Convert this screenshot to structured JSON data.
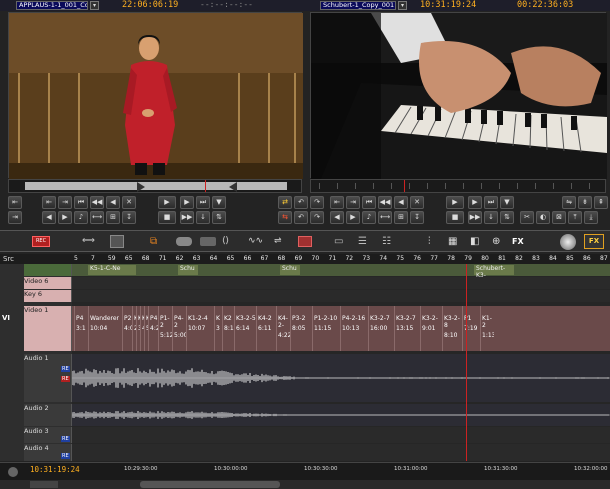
{
  "source_monitor": {
    "clip_name": "APPLAUS-1-1_001_Cop",
    "timecode": "22:06:06:19",
    "timecode_dim": "--:--:--:--"
  },
  "record_monitor": {
    "clip_name": "Schubert-1_Copy_001",
    "timecode": "10:31:19:24",
    "duration": "00:22:36:03"
  },
  "timeline": {
    "src_label": "Src",
    "ruler_numbers": [
      "5",
      "7",
      "59",
      "65",
      "68",
      "71",
      "62",
      "63",
      "64",
      "65",
      "66",
      "67",
      "68",
      "69",
      "70",
      "71",
      "72",
      "73",
      "74",
      "75",
      "76",
      "77",
      "78",
      "79",
      "80",
      "81",
      "82",
      "83",
      "84",
      "85",
      "86",
      "87"
    ],
    "filler_labels": [
      "K5-1-C-Ne",
      "Schu",
      "Schu",
      "Schubert-K3-"
    ],
    "tracks": {
      "video6": "Video 6",
      "key6": "Key 6",
      "vi": "VI",
      "video1": "Video 1",
      "audio1": "Audio 1",
      "audio2": "Audio 2",
      "audio3": "Audio 3",
      "audio4": "Audio 4"
    },
    "audio_markers": [
      "RE",
      "RE",
      "RE",
      "RE"
    ],
    "video_clips": [
      {
        "name": "P4",
        "tc": "3:1"
      },
      {
        "name": "Wanderer",
        "tc": "10:04"
      },
      {
        "name": "P2",
        "tc": "4:0"
      },
      {
        "name": "K",
        "tc": "2:"
      },
      {
        "name": "K",
        "tc": "3"
      },
      {
        "name": "K",
        "tc": "4"
      },
      {
        "name": "K",
        "tc": "5"
      },
      {
        "name": "P4",
        "tc": "4:28"
      },
      {
        "name": "P1-2",
        "tc": "5:12"
      },
      {
        "name": "P4-2",
        "tc": "5:00"
      },
      {
        "name": "K1-2-4",
        "tc": "10:07"
      },
      {
        "name": "K",
        "tc": "3"
      },
      {
        "name": "K2",
        "tc": "8:1"
      },
      {
        "name": "K3-2-5",
        "tc": "6:14"
      },
      {
        "name": "K4-2",
        "tc": "6:11"
      },
      {
        "name": "K4-2-",
        "tc": "4:22"
      },
      {
        "name": "P3-2",
        "tc": "8:05"
      },
      {
        "name": "P1-2-10",
        "tc": "11:15"
      },
      {
        "name": "P4-2-16",
        "tc": "10:13"
      },
      {
        "name": "K3-2-7",
        "tc": "16:00"
      },
      {
        "name": "K3-2-7",
        "tc": "13:15"
      },
      {
        "name": "K3-2-",
        "tc": "9:01"
      },
      {
        "name": "K3-2-8",
        "tc": "8:10"
      },
      {
        "name": "P1",
        "tc": "7:19"
      },
      {
        "name": "K1-2",
        "tc": "1:13"
      }
    ],
    "bottom_timecode": "10:31:19:24",
    "bottom_ruler": [
      "10:29:30:00",
      "10:30:00:00",
      "10:30:30:00",
      "10:31:00:00",
      "10:31:30:00",
      "10:32:00:00"
    ]
  },
  "toolbar": {
    "fx_label": "FX",
    "record_label": "REC"
  },
  "colors": {
    "accent_timecode": "#ffb020",
    "clip_fill": "#6a4a4a",
    "audio_wave": "#e8e8e8",
    "playhead": "#cc2222"
  }
}
